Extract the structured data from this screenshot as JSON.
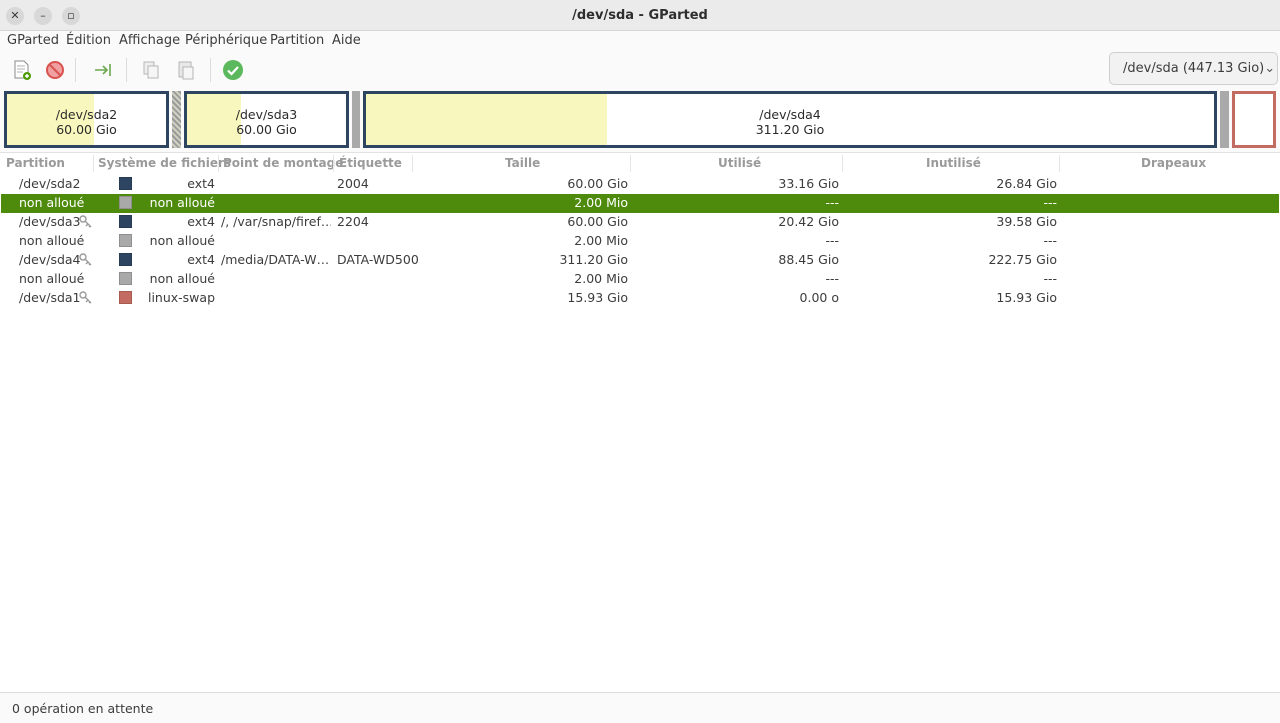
{
  "window": {
    "title": "/dev/sda - GParted",
    "close_glyph": "✕",
    "minimize_glyph": "–",
    "maximize_glyph": "▫"
  },
  "menu": [
    "GParted",
    "Édition",
    "Affichage",
    "Périphérique",
    "Partition",
    "Aide"
  ],
  "toolbar": {
    "icons": [
      "new-partition-icon",
      "delete-icon",
      "resize-move-icon",
      "copy-icon",
      "paste-icon",
      "apply-icon"
    ]
  },
  "device": {
    "label": "/dev/sda (447.13 Gio)",
    "chevron": "⌄"
  },
  "diskmap": {
    "sda2": {
      "name": "/dev/sda2",
      "size": "60.00 Gio",
      "used_fraction": 0.55
    },
    "sda3": {
      "name": "/dev/sda3",
      "size": "60.00 Gio",
      "used_fraction": 0.34
    },
    "sda4": {
      "name": "/dev/sda4",
      "size": "311.20 Gio",
      "used_fraction": 0.284
    },
    "colors": {
      "used": "#f8f8be",
      "border_ext4": "#2e4562",
      "border_swap": "#c36b60",
      "unallocated": "#a9a9a9"
    }
  },
  "table": {
    "headers": {
      "partition": "Partition",
      "filesystem": "Système de fichiers",
      "mount": "Point de montage",
      "label": "Étiquette",
      "size": "Taille",
      "used": "Utilisé",
      "unused": "Inutilisé",
      "flags": "Drapeaux"
    },
    "rows": [
      {
        "partition": "/dev/sda2",
        "key": false,
        "fs_color": "#2e4562",
        "fs": "ext4",
        "mount": "",
        "label": "2004",
        "size": "60.00 Gio",
        "used": "33.16 Gio",
        "unused": "26.84 Gio",
        "flags": ""
      },
      {
        "partition": "non alloué",
        "key": false,
        "fs_color": "#a9a9a9",
        "fs": "non alloué",
        "mount": "",
        "label": "",
        "size": "2.00 Mio",
        "used": "---",
        "unused": "---",
        "flags": ""
      },
      {
        "partition": "/dev/sda3",
        "key": true,
        "fs_color": "#2e4562",
        "fs": "ext4",
        "mount": "/, /var/snap/firef…",
        "label": "2204",
        "size": "60.00 Gio",
        "used": "20.42 Gio",
        "unused": "39.58 Gio",
        "flags": ""
      },
      {
        "partition": "non alloué",
        "key": false,
        "fs_color": "#a9a9a9",
        "fs": "non alloué",
        "mount": "",
        "label": "",
        "size": "2.00 Mio",
        "used": "---",
        "unused": "---",
        "flags": ""
      },
      {
        "partition": "/dev/sda4",
        "key": true,
        "fs_color": "#2e4562",
        "fs": "ext4",
        "mount": "/media/DATA-W…",
        "label": "DATA-WD500",
        "size": "311.20 Gio",
        "used": "88.45 Gio",
        "unused": "222.75 Gio",
        "flags": ""
      },
      {
        "partition": "non alloué",
        "key": false,
        "fs_color": "#a9a9a9",
        "fs": "non alloué",
        "mount": "",
        "label": "",
        "size": "2.00 Mio",
        "used": "---",
        "unused": "---",
        "flags": ""
      },
      {
        "partition": "/dev/sda1",
        "key": true,
        "fs_color": "#c36b60",
        "fs": "linux-swap",
        "mount": "",
        "label": "",
        "size": "15.93 Gio",
        "used": "0.00 o",
        "unused": "15.93 Gio",
        "flags": ""
      }
    ],
    "selected_index": 1,
    "selected_color": "#4e8b0c"
  },
  "status": {
    "text": "0 opération en attente"
  }
}
